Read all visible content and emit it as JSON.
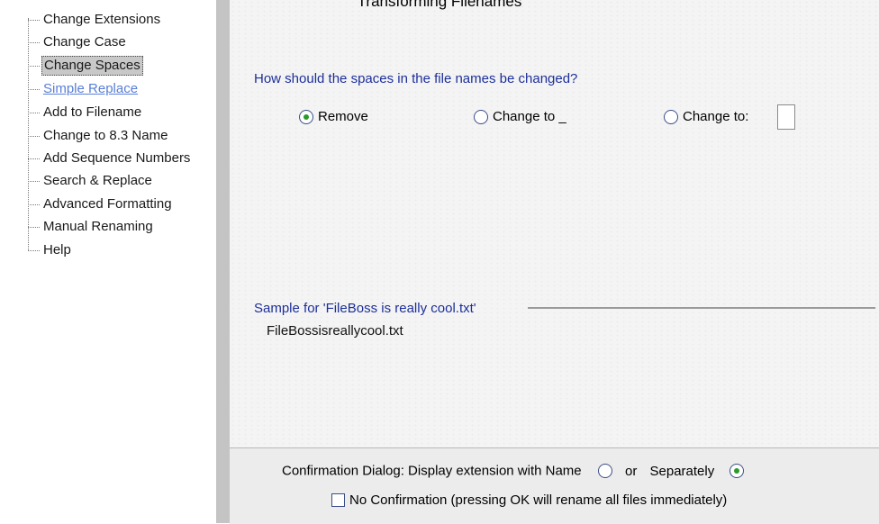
{
  "window": {
    "title": "Transforming Filenames"
  },
  "sidebar": {
    "items": [
      {
        "label": "Change Extensions"
      },
      {
        "label": "Change Case"
      },
      {
        "label": "Change Spaces",
        "selected": true
      },
      {
        "label": "Simple Replace",
        "link": true
      },
      {
        "label": "Add to Filename"
      },
      {
        "label": "Change to 8.3 Name"
      },
      {
        "label": "Add Sequence Numbers"
      },
      {
        "label": "Search & Replace"
      },
      {
        "label": "Advanced Formatting"
      },
      {
        "label": "Manual Renaming"
      },
      {
        "label": "Help"
      }
    ]
  },
  "main": {
    "question": "How should the spaces in the file names be changed?",
    "options": {
      "remove": "Remove",
      "underscore": "Change to _",
      "custom": "Change to:"
    },
    "selected_option": "remove",
    "custom_value": "",
    "sample": {
      "label": "Sample for 'FileBoss is really cool.txt'",
      "value": "FileBossisreallycool.txt"
    }
  },
  "footer": {
    "confirm_label": "Confirmation Dialog: Display extension with Name",
    "or_label": "or",
    "separately_label": "Separately",
    "separately_selected": true,
    "no_confirmation_label": "No Confirmation (pressing OK will rename all files immediately)",
    "no_confirmation_checked": false
  },
  "colors": {
    "heading": "#1c2f9a",
    "radio_dot": "#2a9a2a",
    "link": "#5a7fd6",
    "selection": "#c8c8c8"
  }
}
